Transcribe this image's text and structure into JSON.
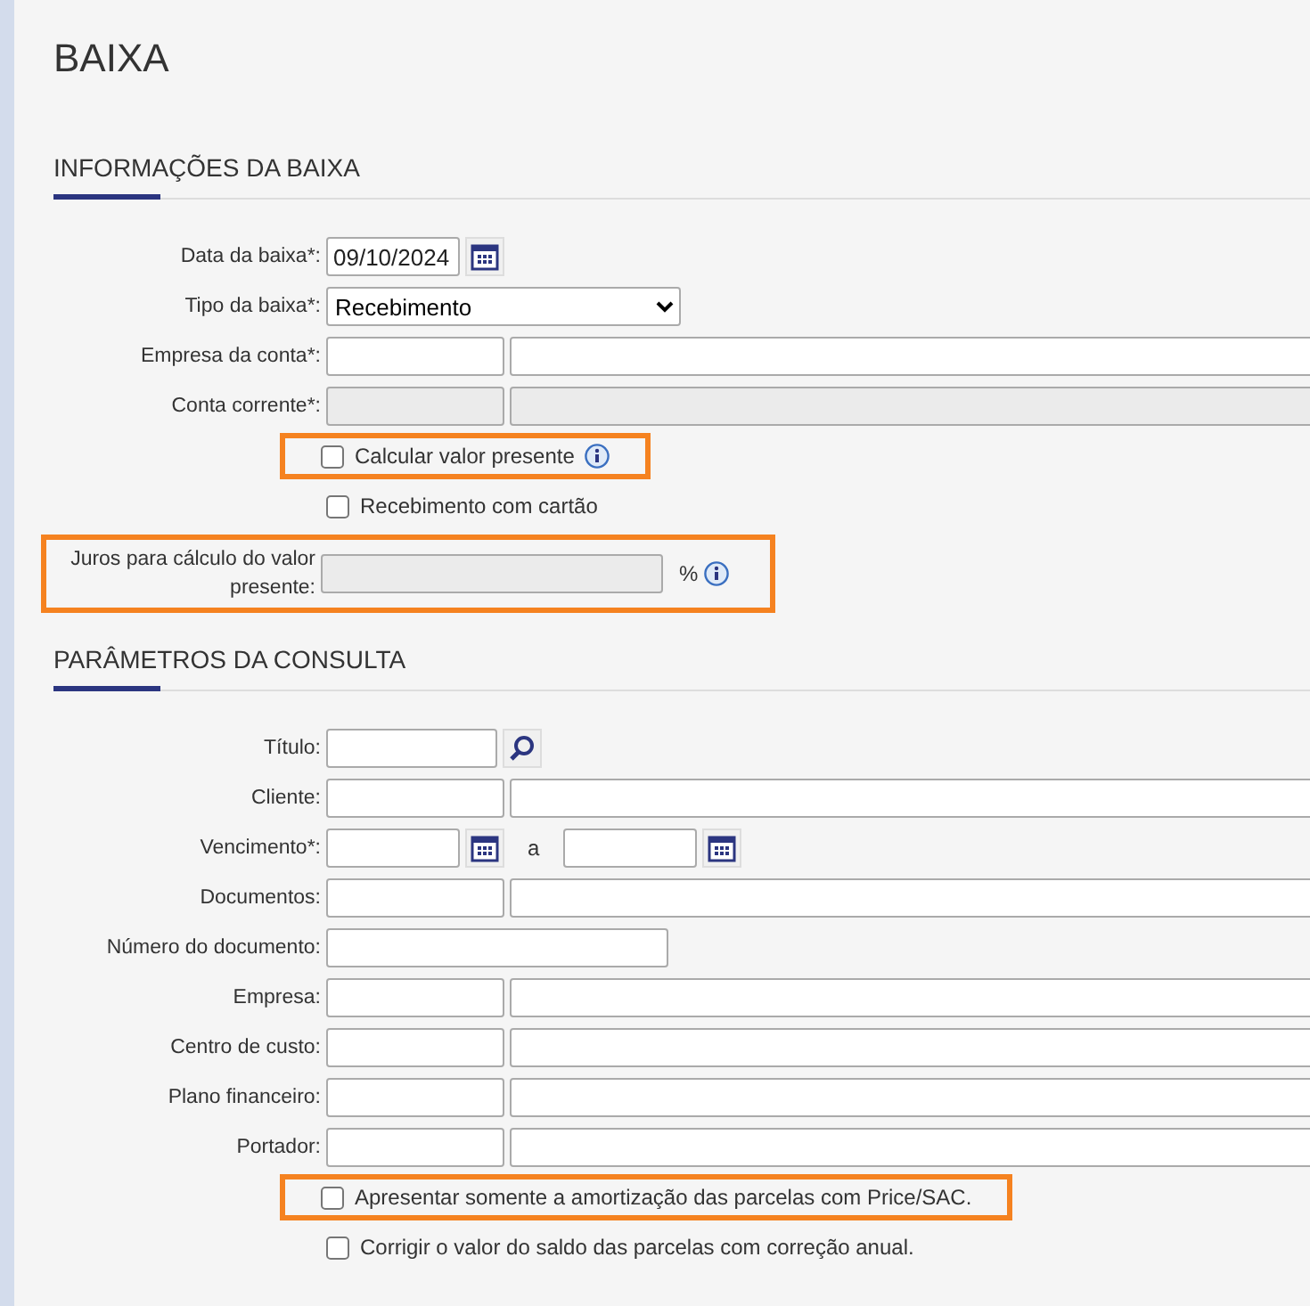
{
  "title": "BAIXA",
  "sections": [
    {
      "title": "INFORMAÇÕES DA BAIXA",
      "rows": [
        {
          "kind": "date",
          "label": "Data da baixa*:",
          "value": "09/10/2024",
          "disabled": false,
          "highlighted": false
        },
        {
          "kind": "select",
          "label": "Tipo da baixa*:",
          "value": "Recebimento",
          "disabled": false,
          "highlighted": false
        },
        {
          "kind": "pair",
          "label": "Empresa da conta*:",
          "disabled": false,
          "highlighted": false
        },
        {
          "kind": "pair",
          "label": "Conta corrente*:",
          "disabled": true,
          "highlighted": false
        },
        {
          "kind": "checkbox",
          "label": "Calcular valor presente",
          "checked": false,
          "info": true,
          "highlighted": true
        },
        {
          "kind": "checkbox",
          "label": "Recebimento com cartão",
          "checked": false,
          "info": false,
          "highlighted": false
        },
        {
          "kind": "percent",
          "label": "Juros para cálculo do valor presente:",
          "unit": "%",
          "disabled": true,
          "highlighted": true
        }
      ]
    },
    {
      "title": "PARÂMETROS DA CONSULTA",
      "rows": [
        {
          "kind": "lookup",
          "label": "Título:",
          "disabled": false,
          "highlighted": false
        },
        {
          "kind": "pair",
          "label": "Cliente:",
          "disabled": false,
          "highlighted": false
        },
        {
          "kind": "range",
          "label": "Vencimento*:",
          "separator": "a",
          "disabled": false,
          "highlighted": false
        },
        {
          "kind": "pair",
          "label": "Documentos:",
          "disabled": false,
          "highlighted": false
        },
        {
          "kind": "wide",
          "label": "Número do documento:",
          "disabled": false,
          "highlighted": false
        },
        {
          "kind": "pair",
          "label": "Empresa:",
          "disabled": false,
          "highlighted": false
        },
        {
          "kind": "pair",
          "label": "Centro de custo:",
          "disabled": false,
          "highlighted": false
        },
        {
          "kind": "pair",
          "label": "Plano financeiro:",
          "disabled": false,
          "highlighted": false
        },
        {
          "kind": "pair",
          "label": "Portador:",
          "disabled": false,
          "highlighted": false
        },
        {
          "kind": "checkbox",
          "label": "Apresentar somente a amortização das parcelas com Price/SAC.",
          "checked": false,
          "info": false,
          "highlighted": true
        },
        {
          "kind": "checkbox",
          "label": "Corrigir o valor do saldo das parcelas com correção anual.",
          "checked": false,
          "info": false,
          "highlighted": false
        }
      ]
    }
  ]
}
